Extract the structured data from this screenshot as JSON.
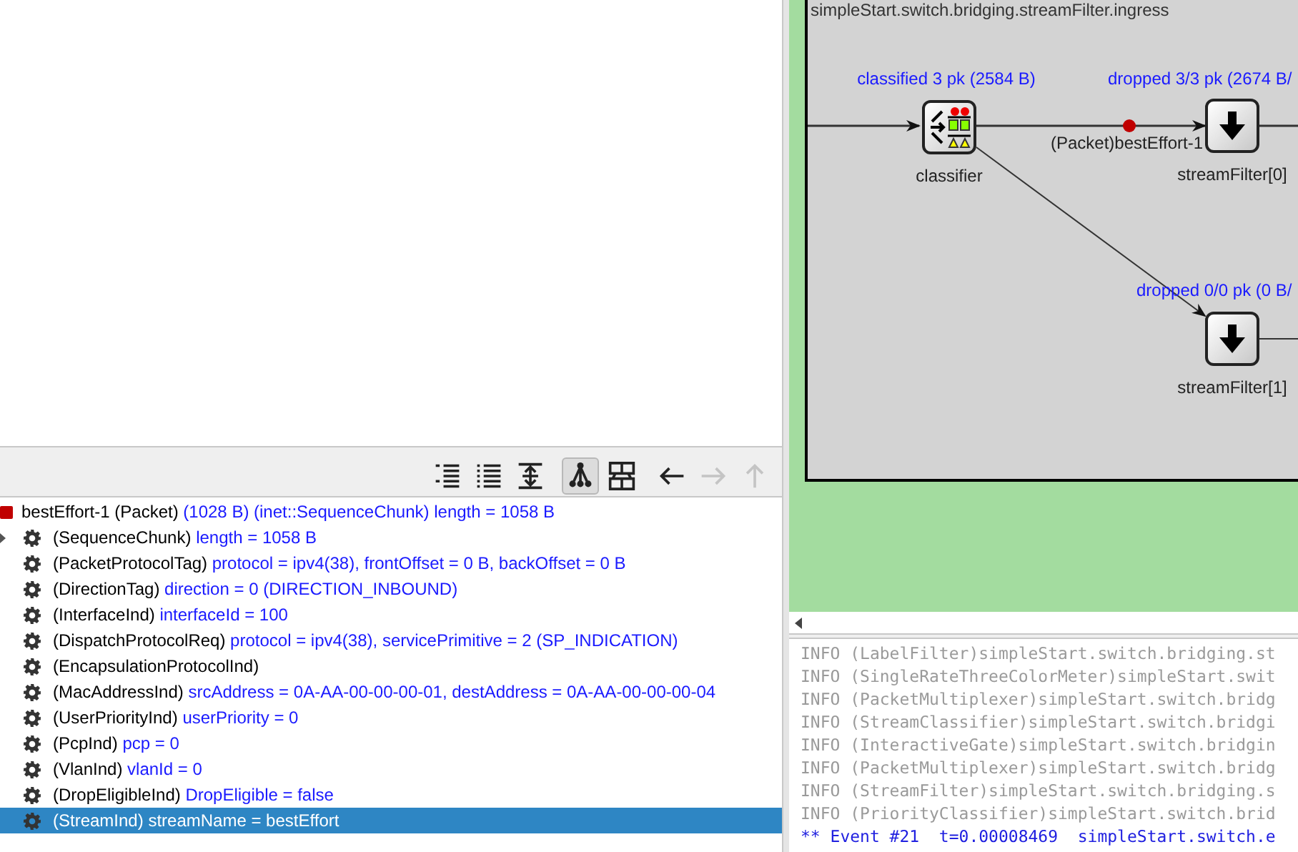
{
  "toolbar": [
    {
      "kind": "list-indent",
      "selected": false,
      "disabled": false
    },
    {
      "kind": "list",
      "selected": false,
      "disabled": false
    },
    {
      "kind": "expand",
      "selected": false,
      "disabled": false
    },
    {
      "kind": "tree",
      "selected": true,
      "disabled": false
    },
    {
      "kind": "layout",
      "selected": false,
      "disabled": false
    },
    {
      "kind": "back",
      "selected": false,
      "disabled": false
    },
    {
      "kind": "forward",
      "selected": false,
      "disabled": true
    },
    {
      "kind": "up",
      "selected": false,
      "disabled": true
    }
  ],
  "tree": {
    "root": {
      "name": "bestEffort-1 (Packet)",
      "detail": "(1028 B) (inet::SequenceChunk) length = 1058 B"
    },
    "children": [
      {
        "name": "(SequenceChunk)",
        "detail": "length = 1058 B",
        "expandable": true,
        "selected": false
      },
      {
        "name": "(PacketProtocolTag)",
        "detail": "protocol = ipv4(38), frontOffset = 0 B, backOffset = 0 B",
        "expandable": false,
        "selected": false
      },
      {
        "name": "(DirectionTag)",
        "detail": "direction = 0 (DIRECTION_INBOUND)",
        "expandable": false,
        "selected": false
      },
      {
        "name": "(InterfaceInd)",
        "detail": "interfaceId = 100",
        "expandable": false,
        "selected": false
      },
      {
        "name": "(DispatchProtocolReq)",
        "detail": "protocol = ipv4(38), servicePrimitive = 2 (SP_INDICATION)",
        "expandable": false,
        "selected": false
      },
      {
        "name": "(EncapsulationProtocolInd)",
        "expandable": false,
        "selected": false
      },
      {
        "name": "(MacAddressInd)",
        "detail": "srcAddress = 0A-AA-00-00-00-01, destAddress = 0A-AA-00-00-00-04",
        "expandable": false,
        "selected": false
      },
      {
        "name": "(UserPriorityInd)",
        "detail": "userPriority = 0",
        "expandable": false,
        "selected": false
      },
      {
        "name": "(PcpInd)",
        "detail": "pcp = 0",
        "expandable": false,
        "selected": false
      },
      {
        "name": "(VlanInd)",
        "detail": "vlanId = 0",
        "expandable": false,
        "selected": false
      },
      {
        "name": "(DropEligibleInd)",
        "detail": "DropEligible = false",
        "expandable": false,
        "selected": false
      },
      {
        "name": "(StreamInd)",
        "detail": "streamName = bestEffort",
        "expandable": false,
        "selected": true
      }
    ]
  },
  "canvas": {
    "title": "simpleStart.switch.bridging.streamFilter.ingress",
    "nodes": [
      {
        "kind": "classifier",
        "name": "classifier",
        "stats": "classified 3 pk (2584 B)"
      },
      {
        "kind": "filter",
        "name": "streamFilter[0]",
        "stats": "dropped 3/3 pk (2674 B/"
      },
      {
        "kind": "filter",
        "name": "streamFilter[1]",
        "stats": "dropped 0/0 pk (0 B/"
      }
    ],
    "message": "(Packet)bestEffort-1"
  },
  "log": [
    {
      "kind": "info",
      "text": "INFO (LabelFilter)simpleStart.switch.bridging.st"
    },
    {
      "kind": "info",
      "text": "INFO (SingleRateThreeColorMeter)simpleStart.swit"
    },
    {
      "kind": "info",
      "text": "INFO (PacketMultiplexer)simpleStart.switch.bridg"
    },
    {
      "kind": "info",
      "text": "INFO (StreamClassifier)simpleStart.switch.bridgi"
    },
    {
      "kind": "info",
      "text": "INFO (InteractiveGate)simpleStart.switch.bridgin"
    },
    {
      "kind": "info",
      "text": "INFO (PacketMultiplexer)simpleStart.switch.bridg"
    },
    {
      "kind": "info",
      "text": "INFO (StreamFilter)simpleStart.switch.bridging.s"
    },
    {
      "kind": "info",
      "text": "INFO (PriorityClassifier)simpleStart.switch.brid"
    },
    {
      "kind": "event",
      "text": "** Event #21  t=0.00008469  simpleStart.switch.e"
    }
  ]
}
